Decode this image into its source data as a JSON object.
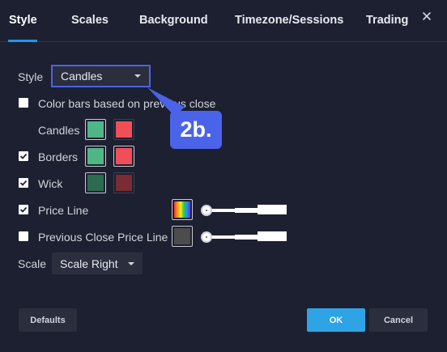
{
  "tabs": [
    {
      "label": "Style",
      "active": true
    },
    {
      "label": "Scales",
      "active": false
    },
    {
      "label": "Background",
      "active": false
    },
    {
      "label": "Timezone/Sessions",
      "active": false
    },
    {
      "label": "Trading",
      "active": false
    }
  ],
  "style_row": {
    "label": "Style",
    "value": "Candles"
  },
  "color_bars": {
    "label": "Color bars based on previous close",
    "checked": false
  },
  "candles": {
    "label": "Candles",
    "up_color": "#4fb687",
    "down_color": "#f04f5a"
  },
  "borders": {
    "label": "Borders",
    "checked": true,
    "up_color": "#4fb687",
    "down_color": "#f04f5a"
  },
  "wick": {
    "label": "Wick",
    "checked": true,
    "up_color": "#2b6b50",
    "down_color": "#7a2b33"
  },
  "price_line": {
    "label": "Price Line",
    "checked": true,
    "swatch": "rainbow-icon"
  },
  "prev_close_line": {
    "label": "Previous Close Price Line",
    "checked": false,
    "color": "#4c4c4c"
  },
  "scale_row": {
    "label": "Scale",
    "value": "Scale Right"
  },
  "buttons": {
    "defaults": "Defaults",
    "ok": "OK",
    "cancel": "Cancel"
  },
  "callout": {
    "text": "2b.",
    "color": "#4a63e8"
  },
  "colors": {
    "accent": "#2196f3",
    "ok": "#2ea3e6",
    "background": "#1c2030"
  }
}
